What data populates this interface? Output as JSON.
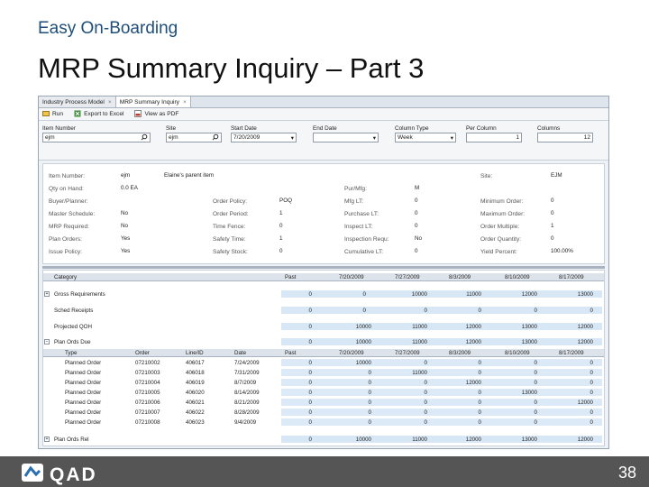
{
  "slide": {
    "subtitle": "Easy On-Boarding",
    "title": "MRP Summary Inquiry – Part 3",
    "page_number": "38",
    "logo_text": "QAD"
  },
  "tabs": [
    {
      "label": "Industry Process Model",
      "close": "×"
    },
    {
      "label": "MRP Summary Inquiry",
      "close": "×"
    }
  ],
  "toolbar": {
    "run": "Run",
    "export": "Export to Excel",
    "pdf": "View as PDF"
  },
  "filters": {
    "item": {
      "label": "Item Number",
      "value": "ejm"
    },
    "site": {
      "label": "Site",
      "value": "ejm"
    },
    "start": {
      "label": "Start Date",
      "value": "7/20/2009"
    },
    "end": {
      "label": "End Date",
      "value": ""
    },
    "coltype": {
      "label": "Column Type",
      "value": "Week"
    },
    "percol": {
      "label": "Per Column",
      "value": "1"
    },
    "columns": {
      "label": "Columns",
      "value": "12"
    }
  },
  "info": {
    "item_number": {
      "label": "Item Number:",
      "value": "ejm"
    },
    "item_desc": "Elaine's parent item",
    "qoh": {
      "label": "Qty on Hand:",
      "value": "0.0 EA"
    },
    "buyer": {
      "label": "Buyer/Planner:",
      "value": ""
    },
    "master_schedule": {
      "label": "Master Schedule:",
      "value": "No"
    },
    "mrp_required": {
      "label": "MRP Required:",
      "value": "No"
    },
    "plan_orders": {
      "label": "Plan Orders:",
      "value": "Yes"
    },
    "issue_policy": {
      "label": "Issue Policy:",
      "value": "Yes"
    },
    "order_policy": {
      "label": "Order Policy:",
      "value": "POQ"
    },
    "order_period": {
      "label": "Order Period:",
      "value": "1"
    },
    "time_fence": {
      "label": "Time Fence:",
      "value": "0"
    },
    "safety_time": {
      "label": "Safety Time:",
      "value": "1"
    },
    "safety_stock": {
      "label": "Safety Stock:",
      "value": "0"
    },
    "pur_mfg": {
      "label": "Pur/Mfg:",
      "value": "M"
    },
    "mfg_lt": {
      "label": "Mfg LT:",
      "value": "0"
    },
    "purchase_lt": {
      "label": "Purchase LT:",
      "value": "0"
    },
    "inspect_lt": {
      "label": "Inspect LT:",
      "value": "0"
    },
    "inspection_req": {
      "label": "Inspection Requ:",
      "value": "No"
    },
    "cumulative_lt": {
      "label": "Cumulative LT:",
      "value": "0"
    },
    "site": {
      "label": "Site:",
      "value": "EJM"
    },
    "min_order": {
      "label": "Minimum Order:",
      "value": "0"
    },
    "max_order": {
      "label": "Maximum Order:",
      "value": "0"
    },
    "order_multiple": {
      "label": "Order Multiple:",
      "value": "1"
    },
    "order_quantity": {
      "label": "Order Quantity:",
      "value": "0"
    },
    "yield_percent": {
      "label": "Yield Percent:",
      "value": "100.00%"
    }
  },
  "summary": {
    "header": [
      "Category",
      "Past",
      "7/20/2009",
      "7/27/2009",
      "8/3/2009",
      "8/10/2009",
      "8/17/2009"
    ],
    "rows": [
      {
        "expander": "+",
        "label": "Gross Requirements",
        "values": [
          "0",
          "0",
          "10000",
          "11000",
          "12000",
          "13000"
        ]
      },
      {
        "expander": "",
        "label": "Sched Receipts",
        "values": [
          "0",
          "0",
          "0",
          "0",
          "0",
          "0"
        ]
      },
      {
        "expander": "",
        "label": "Projected QOH",
        "values": [
          "0",
          "10000",
          "11000",
          "12000",
          "13000",
          "12000"
        ]
      },
      {
        "expander": "−",
        "label": "Plan Ords Due",
        "values": [
          "0",
          "10000",
          "11000",
          "12000",
          "13000",
          "12000"
        ]
      }
    ],
    "last_row": {
      "expander": "+",
      "label": "Plan Ords Rel",
      "values": [
        "0",
        "10000",
        "11000",
        "12000",
        "13000",
        "12000"
      ]
    }
  },
  "detail": {
    "header": [
      "Type",
      "Order",
      "Line/ID",
      "Date",
      "Past",
      "7/20/2009",
      "7/27/2009",
      "8/3/2009",
      "8/10/2009",
      "8/17/2009"
    ],
    "rows": [
      [
        "Planned Order",
        "07210002",
        "406017",
        "7/24/2009",
        "0",
        "10000",
        "0",
        "0",
        "0",
        "0"
      ],
      [
        "Planned Order",
        "07210003",
        "406018",
        "7/31/2009",
        "0",
        "0",
        "11000",
        "0",
        "0",
        "0"
      ],
      [
        "Planned Order",
        "07210004",
        "406019",
        "8/7/2009",
        "0",
        "0",
        "0",
        "12000",
        "0",
        "0"
      ],
      [
        "Planned Order",
        "07210005",
        "406020",
        "8/14/2009",
        "0",
        "0",
        "0",
        "0",
        "13000",
        "0"
      ],
      [
        "Planned Order",
        "07210006",
        "406021",
        "8/21/2009",
        "0",
        "0",
        "0",
        "0",
        "0",
        "12000"
      ],
      [
        "Planned Order",
        "07210007",
        "406022",
        "8/28/2009",
        "0",
        "0",
        "0",
        "0",
        "0",
        "0"
      ],
      [
        "Planned Order",
        "07210008",
        "406023",
        "9/4/2009",
        "0",
        "0",
        "0",
        "0",
        "0",
        "0"
      ]
    ]
  }
}
